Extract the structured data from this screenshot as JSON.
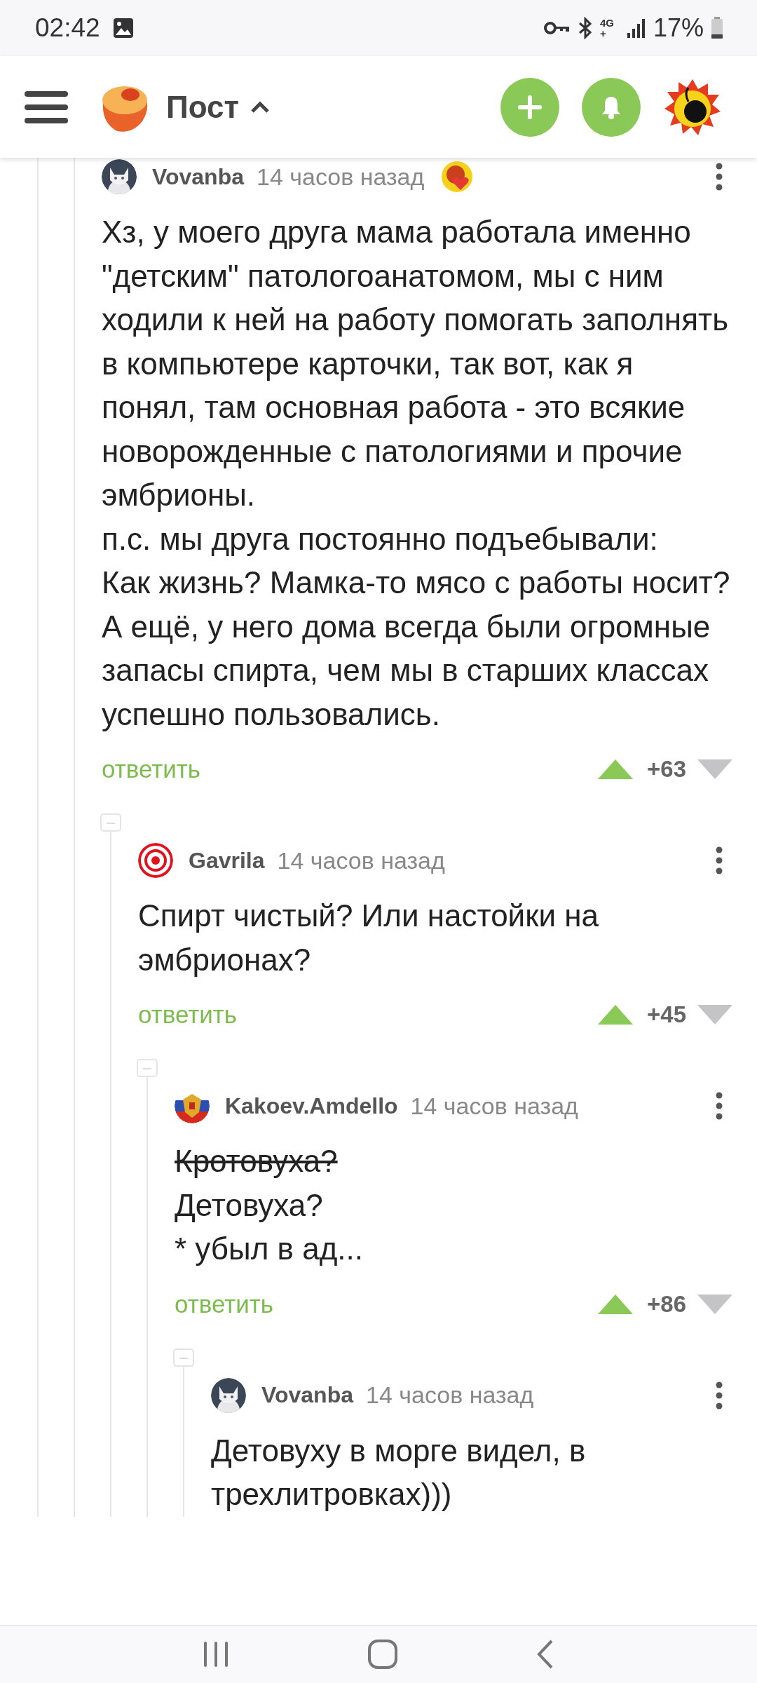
{
  "status_bar": {
    "time": "02:42",
    "network": "4G+",
    "battery": "17%"
  },
  "header": {
    "title": "Пост"
  },
  "comments": [
    {
      "author": "Vovanba",
      "time": "14 часов назад",
      "avatar": {
        "kind": "cat"
      },
      "award": true,
      "paragraphs": [
        {
          "text": "Хз, у моего друга мама работала именно \"детским\" патологоанатомом, мы с ним ходили к ней на работу помогать заполнять в компьютере карточки, так вот, как я понял, там основная работа - это всякие новорожденные с патологиями и прочие эмбрионы.",
          "struck": false
        },
        {
          "text": "п.с. мы друга постоянно подъебывали:",
          "struck": false
        },
        {
          "text": "Как жизнь? Мамка-то мясо с работы носит?",
          "struck": false
        },
        {
          "text": "А ещё, у него дома всегда были огромные запасы спирта, чем мы в старших классах успешно пользовались.",
          "struck": false
        }
      ],
      "reply": "ответить",
      "score": "+63",
      "children": [
        {
          "author": "Gavrila",
          "time": "14 часов назад",
          "avatar": {
            "kind": "target"
          },
          "award": false,
          "paragraphs": [
            {
              "text": "Спирт чистый? Или настойки на эмбрионах?",
              "struck": false
            }
          ],
          "reply": "ответить",
          "score": "+45",
          "children": [
            {
              "author": "Kakoev.Amdello",
              "time": "14 часов назад",
              "avatar": {
                "kind": "emblem"
              },
              "award": false,
              "paragraphs": [
                {
                  "text": "Кротовуха?",
                  "struck": true
                },
                {
                  "text": "Детовуха?",
                  "struck": false
                },
                {
                  "text": "* убыл в ад...",
                  "struck": false
                }
              ],
              "reply": "ответить",
              "score": "+86",
              "children": [
                {
                  "author": "Vovanba",
                  "time": "14 часов назад",
                  "avatar": {
                    "kind": "cat"
                  },
                  "award": false,
                  "paragraphs": [
                    {
                      "text": "Детовуху в морге видел, в трехлитровках)))",
                      "struck": false
                    }
                  ]
                }
              ]
            }
          ]
        }
      ]
    }
  ]
}
